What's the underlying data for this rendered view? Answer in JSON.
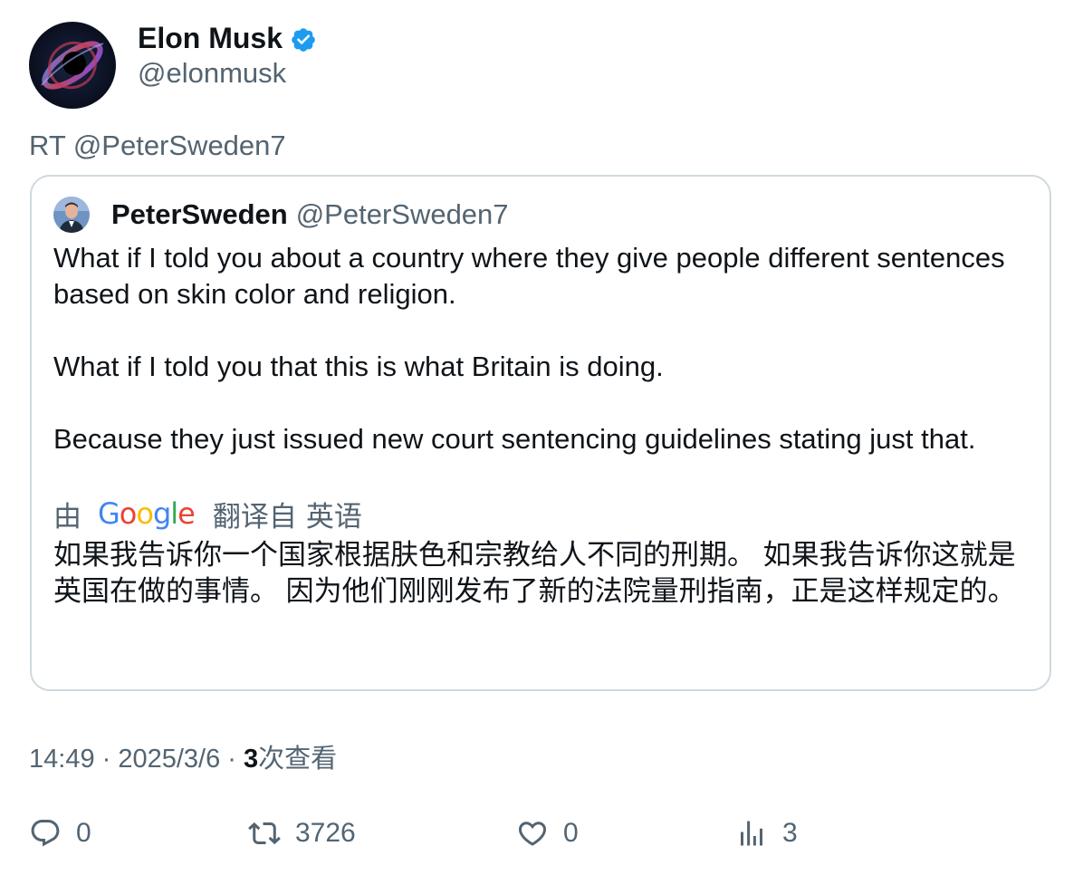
{
  "author": {
    "display_name": "Elon Musk",
    "handle": "@elonmusk",
    "verified": true,
    "verified_color": "#1d9bf0",
    "avatar_icon": "black-hole-avatar"
  },
  "retweet_line": "RT @PeterSweden7",
  "quoted": {
    "display_name": "PeterSweden",
    "handle": "@PeterSweden7",
    "avatar_icon": "person-avatar",
    "paragraphs": [
      "What if I told you about a country where they give people different sentences based on skin color and religion.",
      "What if I told you that this is what Britain is doing.",
      "Because they just issued new court sentencing guidelines stating just that."
    ],
    "translation_label": {
      "by": "由",
      "provider": "Google",
      "translated_from": "翻译自",
      "source_language": "英语"
    },
    "translation_text": "如果我告诉你一个国家根据肤色和宗教给人不同的刑期。 如果我告诉你这就是英国在做的事情。 因为他们刚刚发布了新的法院量刑指南，正是这样规定的。"
  },
  "meta": {
    "time": "14:49",
    "separator": " · ",
    "date": "2025/3/6",
    "views_count": "3",
    "views_label": "次查看"
  },
  "actions": {
    "replies": "0",
    "retweets": "3726",
    "likes": "0",
    "views": "3"
  },
  "colors": {
    "text_primary": "#0f1419",
    "text_secondary": "#536471",
    "border": "#cfd9de",
    "google_blue": "#4285f4",
    "google_red": "#ea4335",
    "google_yellow": "#fbbc05",
    "google_green": "#34a853"
  }
}
